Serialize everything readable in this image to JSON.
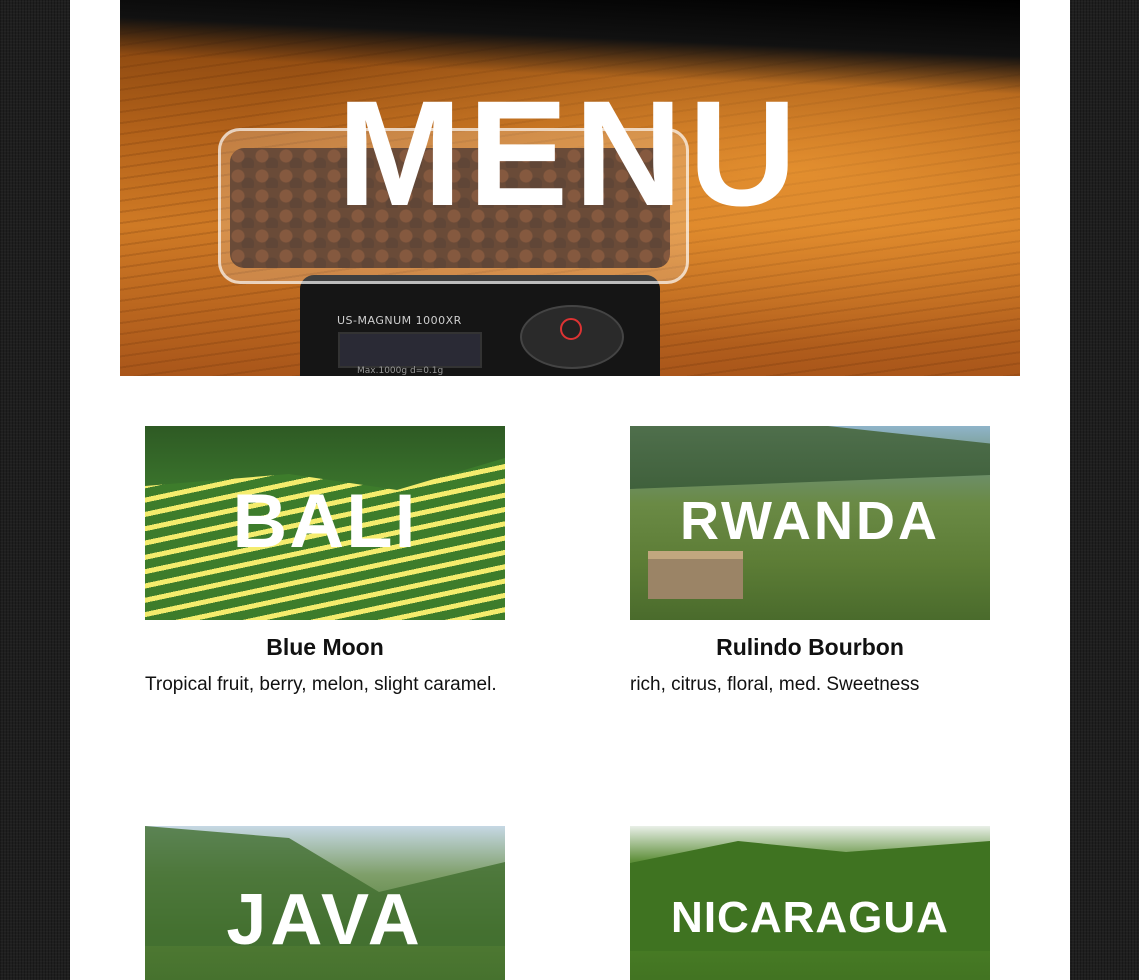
{
  "hero": {
    "title": "MENU",
    "scale_model": "US-MAGNUM  1000XR",
    "scale_caption": "Max.1000g  d=0.1g"
  },
  "menu": [
    {
      "region": "BALI",
      "name": "Blue Moon",
      "description": "Tropical fruit, berry, melon, slight caramel."
    },
    {
      "region": "RWANDA",
      "name": "Rulindo Bourbon",
      "description": "rich, citrus, floral, med. Sweetness"
    },
    {
      "region": "JAVA",
      "name": "",
      "description": ""
    },
    {
      "region": "NICARAGUA",
      "name": "",
      "description": ""
    }
  ],
  "colors": {
    "page_background": "#ffffff",
    "side_background": "#1f1f1f",
    "text": "#111111",
    "overlay_text": "#ffffff"
  }
}
